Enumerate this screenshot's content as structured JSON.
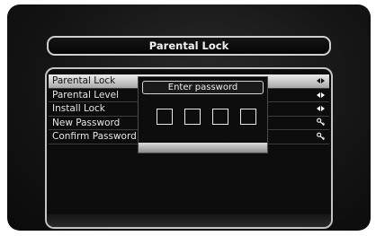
{
  "header": {
    "title": "Parental Lock"
  },
  "menu": {
    "items": [
      {
        "label": "Parental Lock",
        "icon": "left-right-arrows-icon",
        "selected": true
      },
      {
        "label": "Parental Level",
        "icon": "left-right-arrows-icon",
        "selected": false
      },
      {
        "label": "Install Lock",
        "icon": "left-right-arrows-icon",
        "selected": false
      },
      {
        "label": "New Password",
        "icon": "key-icon",
        "selected": false
      },
      {
        "label": "Confirm Password",
        "icon": "key-icon",
        "selected": false
      }
    ]
  },
  "dialog": {
    "title": "Enter password",
    "pin_length": 4
  },
  "colors": {
    "background": "#0a0a0a",
    "border": "#c4c4c4",
    "selected_row": "#cfcfcf"
  }
}
